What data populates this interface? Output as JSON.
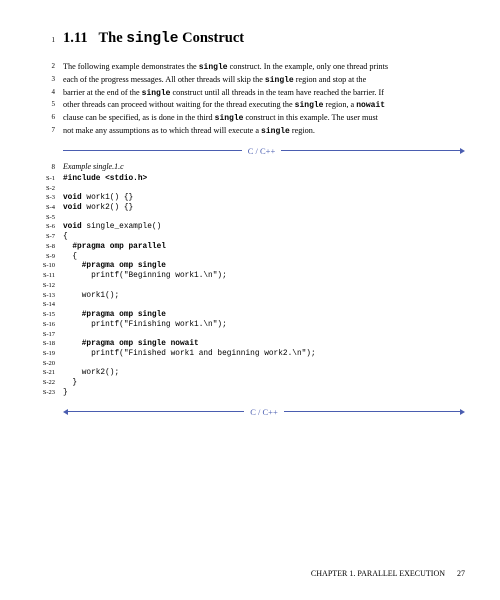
{
  "heading": {
    "margin_num": "1",
    "section_num": "1.11",
    "before": "The ",
    "mono": "single",
    "after": " Construct"
  },
  "para_margins": [
    "2",
    "3",
    "4",
    "5",
    "6",
    "7"
  ],
  "para": {
    "l1a": "The following example demonstrates the ",
    "l1m": "single",
    "l1b": " construct. In the example, only one thread prints",
    "l2a": "each of the progress messages. All other threads will skip the ",
    "l2m": "single",
    "l2b": " region and stop at the",
    "l3a": "barrier at the end of the ",
    "l3m": "single",
    "l3b": " construct until all threads in the team have reached the barrier. If",
    "l4a": "other threads can proceed without waiting for the thread executing the ",
    "l4m1": "single",
    "l4b": " region, a ",
    "l4m2": "nowait",
    "l5a": "clause can be specified, as is done in the third ",
    "l5m": "single",
    "l5b": " construct in this example. The user must",
    "l6a": "not make any assumptions as to which thread will execute a ",
    "l6m": "single",
    "l6b": " region."
  },
  "lang_label": "C / C++",
  "example": {
    "margin": "8",
    "filename": "Example single.1.c"
  },
  "code": [
    {
      "n": "S-1",
      "b": "#include <stdio.h>",
      "t": ""
    },
    {
      "n": "S-2",
      "b": "",
      "t": ""
    },
    {
      "n": "S-3",
      "b": "void",
      "t": " work1() {}"
    },
    {
      "n": "S-4",
      "b": "void",
      "t": " work2() {}"
    },
    {
      "n": "S-5",
      "b": "",
      "t": ""
    },
    {
      "n": "S-6",
      "b": "void",
      "t": " single_example()"
    },
    {
      "n": "S-7",
      "b": "",
      "t": "{"
    },
    {
      "n": "S-8",
      "b": "  #pragma omp parallel",
      "t": ""
    },
    {
      "n": "S-9",
      "b": "",
      "t": "  {"
    },
    {
      "n": "S-10",
      "b": "    #pragma omp single",
      "t": ""
    },
    {
      "n": "S-11",
      "b": "",
      "t": "      printf(\"Beginning work1.\\n\");"
    },
    {
      "n": "S-12",
      "b": "",
      "t": ""
    },
    {
      "n": "S-13",
      "b": "",
      "t": "    work1();"
    },
    {
      "n": "S-14",
      "b": "",
      "t": ""
    },
    {
      "n": "S-15",
      "b": "    #pragma omp single",
      "t": ""
    },
    {
      "n": "S-16",
      "b": "",
      "t": "      printf(\"Finishing work1.\\n\");"
    },
    {
      "n": "S-17",
      "b": "",
      "t": ""
    },
    {
      "n": "S-18",
      "b": "    #pragma omp single nowait",
      "t": ""
    },
    {
      "n": "S-19",
      "b": "",
      "t": "      printf(\"Finished work1 and beginning work2.\\n\");"
    },
    {
      "n": "S-20",
      "b": "",
      "t": ""
    },
    {
      "n": "S-21",
      "b": "",
      "t": "    work2();"
    },
    {
      "n": "S-22",
      "b": "",
      "t": "  }"
    },
    {
      "n": "S-23",
      "b": "",
      "t": "}"
    }
  ],
  "footer": {
    "chapter": "CHAPTER 1.  PARALLEL EXECUTION",
    "page": "27"
  }
}
